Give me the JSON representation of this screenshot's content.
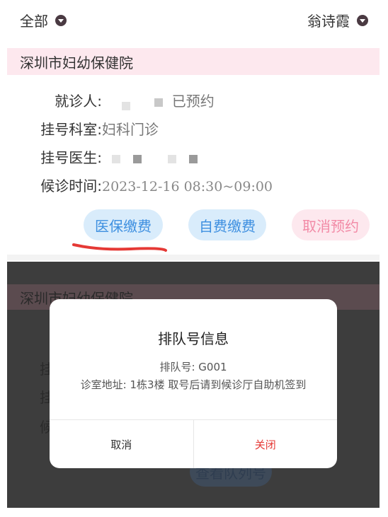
{
  "filters": {
    "category": "全部",
    "patient_filter": "翁诗霞"
  },
  "appointment": {
    "hospital": "深圳市妇幼保健院",
    "patient_label": "就诊人:",
    "patient_value_suffix": "已预约",
    "department_label": "挂号科室:",
    "department_value": "妇科门诊",
    "doctor_label": "挂号医生:",
    "time_label": "候诊时间:",
    "time_value": "2023-12-16 08:30~09:00",
    "actions": {
      "insurance_pay": "医保缴费",
      "self_pay": "自费缴费",
      "cancel": "取消预约"
    }
  },
  "background_card": {
    "hospital": "深圳市妇幼保健院",
    "peek_label_1": "挂",
    "peek_label_2": "挂",
    "peek_label_3": "候",
    "queue_button": "查看队列号"
  },
  "modal": {
    "title": "排队号信息",
    "queue_line": "排队号: G001",
    "address_line": "诊室地址: 1栋3楼 取号后请到候诊厅自助机签到",
    "cancel_label": "取消",
    "close_label": "关闭"
  },
  "colors": {
    "accent_blue": "#3d8fe0",
    "accent_pink": "#f28aa6",
    "annotation_red": "#e53935"
  }
}
